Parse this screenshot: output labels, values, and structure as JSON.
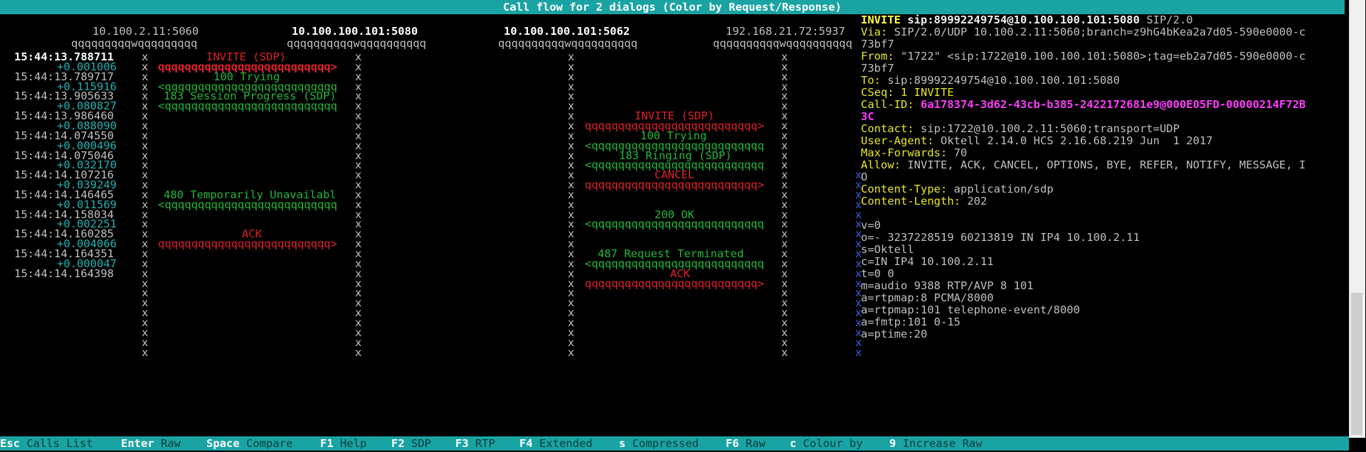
{
  "window": {
    "title": "Call flow for 2 dialogs (Color by Request/Response)"
  },
  "hosts": [
    {
      "addr": "10.100.2.11:5060",
      "bold": false,
      "lane": "qqqqqqqqqwqqqqqqqqq"
    },
    {
      "addr": "10.100.100.101:5080",
      "bold": true,
      "lane": "qqqqqqqqqqwqqqqqqqqqq"
    },
    {
      "addr": "10.100.100.101:5062",
      "bold": true,
      "lane": "qqqqqqqqqqwqqqqqqqqqq"
    },
    {
      "addr": "192.168.21.72:5937",
      "bold": false,
      "lane": "qqqqqqqqqqwqqqqqqqqqq"
    }
  ],
  "timestamps": [
    {
      "time": "15:44:13.788711",
      "delta": "+0.001006",
      "selected": true
    },
    {
      "time": "15:44:13.789717",
      "delta": "+0.115916"
    },
    {
      "time": "15:44:13.905633",
      "delta": "+0.080827"
    },
    {
      "time": "15:44:13.986460",
      "delta": "+0.088090"
    },
    {
      "time": "15:44:14.074550",
      "delta": "+0.000496"
    },
    {
      "time": "15:44:14.075046",
      "delta": "+0.032170"
    },
    {
      "time": "15:44:14.107216",
      "delta": "+0.039249"
    },
    {
      "time": "15:44:14.146465",
      "delta": "+0.011569"
    },
    {
      "time": "15:44:14.158034",
      "delta": "+0.002251"
    },
    {
      "time": "15:44:14.160285",
      "delta": "+0.004066"
    },
    {
      "time": "15:44:14.164351",
      "delta": "+0.000047"
    },
    {
      "time": "15:44:14.164398",
      "delta": ""
    }
  ],
  "messages": [
    {
      "label": "INVITE (SDP)",
      "arrow": "qqqqqqqqqqqqqqqqqqqqqqqqqq>",
      "kind": "req",
      "selected": true
    },
    {
      "label": "100 Trying",
      "arrow": "<qqqqqqqqqqqqqqqqqqqqqqqqqq",
      "kind": "resp"
    },
    {
      "label": "183 Session Progress (SDP)",
      "arrow": "<qqqqqqqqqqqqqqqqqqqqqqqqqq",
      "kind": "resp"
    },
    {
      "label": "INVITE (SDP)",
      "arrow": "qqqqqqqqqqqqqqqqqqqqqqqqqq>",
      "kind": "req"
    },
    {
      "label": "100 Trying",
      "arrow": "<qqqqqqqqqqqqqqqqqqqqqqqqqq",
      "kind": "resp"
    },
    {
      "label": "183 Ringing (SDP)",
      "arrow": "<qqqqqqqqqqqqqqqqqqqqqqqqqq",
      "kind": "resp"
    },
    {
      "label": "CANCEL",
      "arrow": "qqqqqqqqqqqqqqqqqqqqqqqqqq>",
      "kind": "req"
    },
    {
      "label": "480 Temporarily Unavailabl",
      "arrow": "<qqqqqqqqqqqqqqqqqqqqqqqqqq",
      "kind": "resp"
    },
    {
      "label": "200 OK",
      "arrow": "<qqqqqqqqqqqqqqqqqqqqqqqqqq",
      "kind": "resp"
    },
    {
      "label": "ACK",
      "arrow": "qqqqqqqqqqqqqqqqqqqqqqqqqq>",
      "kind": "req"
    },
    {
      "label": "487 Request Terminated",
      "arrow": "<qqqqqqqqqqqqqqqqqqqqqqqqqq",
      "kind": "resp"
    },
    {
      "label": "ACK",
      "arrow": "qqqqqqqqqqqqqqqqqqqqqqqqqq>",
      "kind": "req"
    }
  ],
  "lifeline_glyph": "x",
  "sip_message": {
    "request_line": {
      "method": "INVITE",
      "uri": "sip:89992249754@10.100.100.101:5080",
      "version": "SIP/2.0"
    },
    "headers": [
      {
        "name": "Via:",
        "value": "SIP/2.0/UDP 10.100.2.11:5060;branch=z9hG4bKea2a7d05-590e0000-c"
      },
      {
        "name": "",
        "value": "73bf7"
      },
      {
        "name": "From:",
        "value": "\"1722\" <sip:1722@10.100.100.101:5080>;tag=eb2a7d05-590e0000-c"
      },
      {
        "name": "",
        "value": "73bf7"
      },
      {
        "name": "To:",
        "value": "sip:89992249754@10.100.100.101:5080"
      },
      {
        "name": "CSeq:",
        "value": "1 INVITE",
        "highlight": "yellow"
      },
      {
        "name": "Call-ID:",
        "value": "6a178374-3d62-43cb-b385-2422172681e9@000E05FD-00000214F72B",
        "highlight": "magenta"
      },
      {
        "name": "",
        "value": "3C",
        "highlight": "magenta"
      },
      {
        "name": "Contact:",
        "value": "sip:1722@10.100.2.11:5060;transport=UDP"
      },
      {
        "name": "User-Agent:",
        "value": "Oktell 2.14.0 HCS 2.16.68.219 Jun  1 2017"
      },
      {
        "name": "Max-Forwards:",
        "value": "70"
      },
      {
        "name": "Allow:",
        "value": "INVITE, ACK, CANCEL, OPTIONS, BYE, REFER, NOTIFY, MESSAGE, I"
      },
      {
        "name": "",
        "value": "O"
      },
      {
        "name": "Content-Type:",
        "value": "application/sdp"
      },
      {
        "name": "Content-Length:",
        "value": "202"
      }
    ],
    "sdp": [
      "v=0",
      "o=- 3237228519 60213819 IN IP4 10.100.2.11",
      "s=Oktell",
      "c=IN IP4 10.100.2.11",
      "t=0 0",
      "m=audio 9388 RTP/AVP 8 101",
      "a=rtpmap:8 PCMA/8000",
      "a=rtpmap:101 telephone-event/8000",
      "a=fmtp:101 0-15",
      "a=ptime:20"
    ]
  },
  "footer": [
    {
      "key": "Esc",
      "label": "Calls List"
    },
    {
      "key": "Enter",
      "label": "Raw"
    },
    {
      "key": "Space",
      "label": "Compare"
    },
    {
      "key": "F1",
      "label": "Help"
    },
    {
      "key": "F2",
      "label": "SDP"
    },
    {
      "key": "F3",
      "label": "RTP"
    },
    {
      "key": "F4",
      "label": "Extended"
    },
    {
      "key": "s",
      "label": "Compressed"
    },
    {
      "key": "F6",
      "label": "Raw"
    },
    {
      "key": "c",
      "label": "Colour by"
    },
    {
      "key": "9",
      "label": "Increase Raw"
    }
  ],
  "colors": {
    "bar": "#1aa3a3",
    "request": "#e0202a",
    "response": "#20b83a",
    "delta": "#20b2b2",
    "header_name": "#e8e820",
    "call_id": "#ff3cff"
  }
}
